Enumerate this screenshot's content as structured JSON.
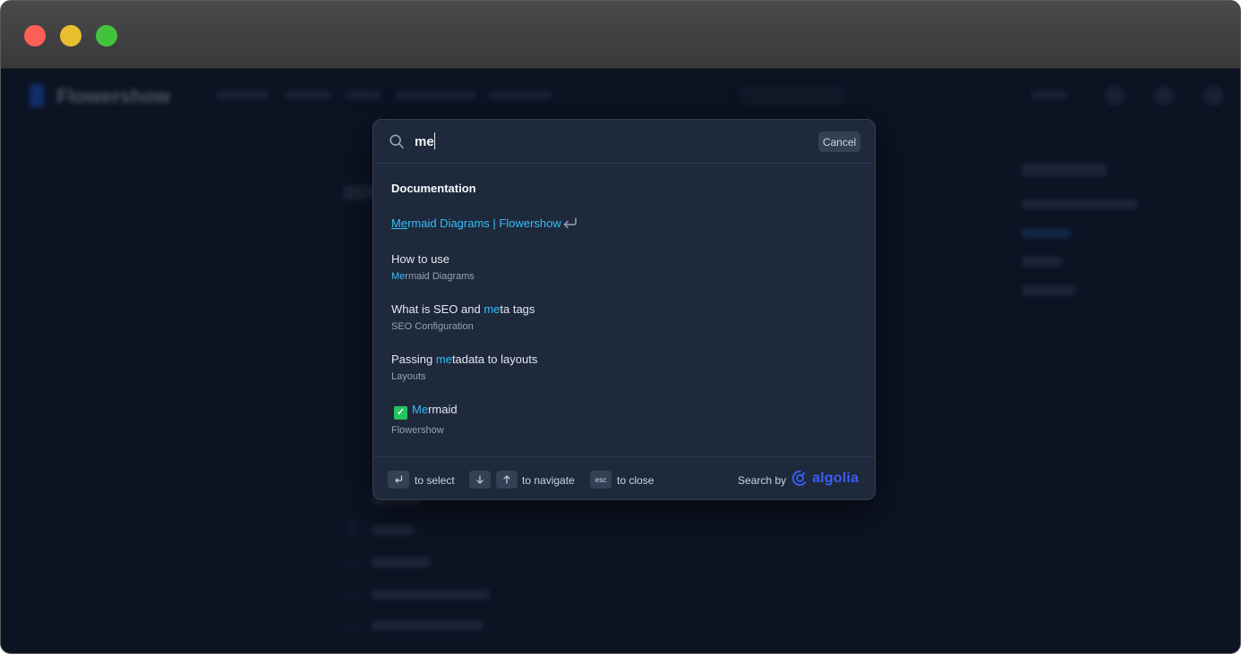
{
  "window": {
    "controls": [
      "close",
      "minimize",
      "zoom"
    ]
  },
  "background": {
    "brand": "Flowershow"
  },
  "search": {
    "query": "me",
    "cancel_label": "Cancel",
    "section_title": "Documentation",
    "hits": [
      {
        "title_hl": "Me",
        "title_rest": "rmaid Diagrams | Flowershow",
        "subtitle": ""
      },
      {
        "title": "How to use",
        "subtitle_hl": "Me",
        "subtitle_rest": "rmaid Diagrams"
      },
      {
        "title_pre": "What is SEO and ",
        "title_hl": "me",
        "title_post": "ta tags",
        "subtitle": "SEO Configuration"
      },
      {
        "title_pre": "Passing ",
        "title_hl": "me",
        "title_post": "tadata to layouts",
        "subtitle": "Layouts"
      },
      {
        "emoji": "✓",
        "title_hl": "Me",
        "title_rest": "rmaid",
        "subtitle": "Flowershow"
      }
    ],
    "footer": {
      "select_label": "to select",
      "navigate_label": "to navigate",
      "close_label": "to close",
      "esc_key": "esc",
      "search_by": "Search by",
      "algolia": "algolia"
    }
  },
  "colors": {
    "accent": "#38bdf8",
    "modal_bg": "#1e293b",
    "algolia": "#3a5cf5"
  }
}
